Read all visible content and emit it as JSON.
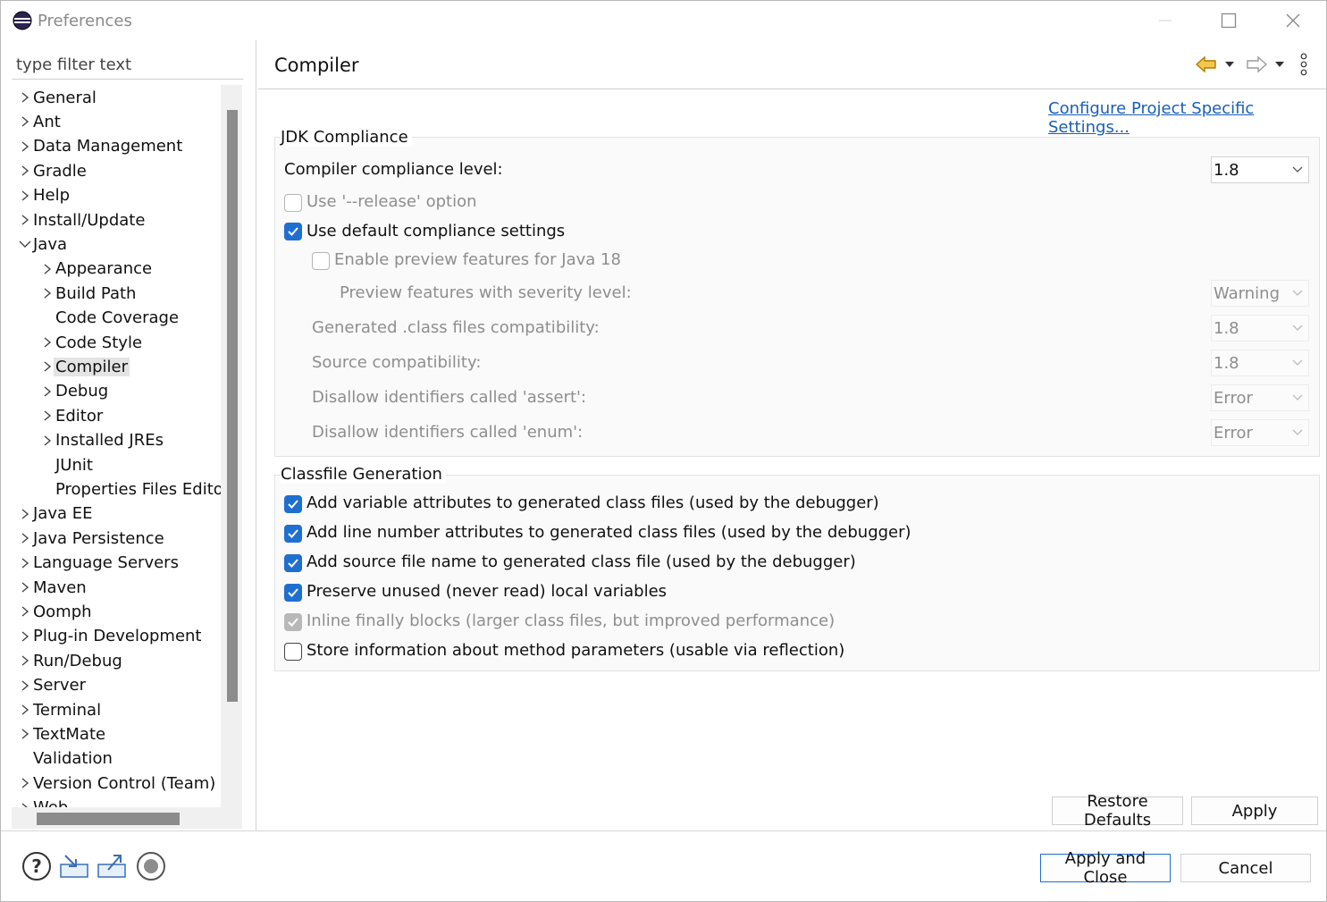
{
  "window": {
    "title": "Preferences"
  },
  "sidebar": {
    "filter_placeholder": "type filter text",
    "items": [
      {
        "label": "General",
        "arrow": "right",
        "level": 0
      },
      {
        "label": "Ant",
        "arrow": "right",
        "level": 0
      },
      {
        "label": "Data Management",
        "arrow": "right",
        "level": 0
      },
      {
        "label": "Gradle",
        "arrow": "right",
        "level": 0
      },
      {
        "label": "Help",
        "arrow": "right",
        "level": 0
      },
      {
        "label": "Install/Update",
        "arrow": "right",
        "level": 0
      },
      {
        "label": "Java",
        "arrow": "down",
        "level": 0
      },
      {
        "label": "Appearance",
        "arrow": "right",
        "level": 1
      },
      {
        "label": "Build Path",
        "arrow": "right",
        "level": 1
      },
      {
        "label": "Code Coverage",
        "arrow": "none",
        "level": 1
      },
      {
        "label": "Code Style",
        "arrow": "right",
        "level": 1
      },
      {
        "label": "Compiler",
        "arrow": "right",
        "level": 1,
        "selected": true
      },
      {
        "label": "Debug",
        "arrow": "right",
        "level": 1
      },
      {
        "label": "Editor",
        "arrow": "right",
        "level": 1
      },
      {
        "label": "Installed JREs",
        "arrow": "right",
        "level": 1
      },
      {
        "label": "JUnit",
        "arrow": "none",
        "level": 1
      },
      {
        "label": "Properties Files Editor",
        "arrow": "none",
        "level": 1
      },
      {
        "label": "Java EE",
        "arrow": "right",
        "level": 0
      },
      {
        "label": "Java Persistence",
        "arrow": "right",
        "level": 0
      },
      {
        "label": "Language Servers",
        "arrow": "right",
        "level": 0
      },
      {
        "label": "Maven",
        "arrow": "right",
        "level": 0
      },
      {
        "label": "Oomph",
        "arrow": "right",
        "level": 0
      },
      {
        "label": "Plug-in Development",
        "arrow": "right",
        "level": 0
      },
      {
        "label": "Run/Debug",
        "arrow": "right",
        "level": 0
      },
      {
        "label": "Server",
        "arrow": "right",
        "level": 0
      },
      {
        "label": "Terminal",
        "arrow": "right",
        "level": 0
      },
      {
        "label": "TextMate",
        "arrow": "right",
        "level": 0
      },
      {
        "label": "Validation",
        "arrow": "none",
        "level": 0
      },
      {
        "label": "Version Control (Team)",
        "arrow": "right",
        "level": 0
      },
      {
        "label": "Web",
        "arrow": "right",
        "level": 0
      }
    ]
  },
  "page": {
    "title": "Compiler",
    "configure_link": "Configure Project Specific Settings...",
    "jdk_group": {
      "title": "JDK Compliance",
      "compliance_label": "Compiler compliance level:",
      "compliance_value": "1.8",
      "release_option": {
        "label": "Use '--release' option",
        "checked": false,
        "disabled": true
      },
      "use_default": {
        "label": "Use default compliance settings",
        "checked": true,
        "disabled": false
      },
      "preview": {
        "label": "Enable preview features for Java 18",
        "checked": false,
        "disabled": true
      },
      "preview_severity_label": "Preview features with severity level:",
      "preview_severity_value": "Warning",
      "class_compat_label": "Generated .class files compatibility:",
      "class_compat_value": "1.8",
      "source_compat_label": "Source compatibility:",
      "source_compat_value": "1.8",
      "assert_label": "Disallow identifiers called 'assert':",
      "assert_value": "Error",
      "enum_label": "Disallow identifiers called 'enum':",
      "enum_value": "Error"
    },
    "classfile_group": {
      "title": "Classfile Generation",
      "options": [
        {
          "label": "Add variable attributes to generated class files (used by the debugger)",
          "checked": true,
          "disabled": false
        },
        {
          "label": "Add line number attributes to generated class files (used by the debugger)",
          "checked": true,
          "disabled": false
        },
        {
          "label": "Add source file name to generated class file (used by the debugger)",
          "checked": true,
          "disabled": false
        },
        {
          "label": "Preserve unused (never read) local variables",
          "checked": true,
          "disabled": false
        },
        {
          "label": "Inline finally blocks (larger class files, but improved performance)",
          "checked": true,
          "disabled": true
        },
        {
          "label": "Store information about method parameters (usable via reflection)",
          "checked": false,
          "disabled": false
        }
      ]
    },
    "restore_defaults": "Restore Defaults",
    "apply": "Apply"
  },
  "footer": {
    "apply_close": "Apply and Close",
    "cancel": "Cancel",
    "icons": [
      "help-icon",
      "import-icon",
      "export-icon",
      "record-icon"
    ]
  },
  "colors": {
    "accent": "#1f6fd0",
    "link": "#1a5fb4",
    "nav_arrow": "#e0a000"
  }
}
